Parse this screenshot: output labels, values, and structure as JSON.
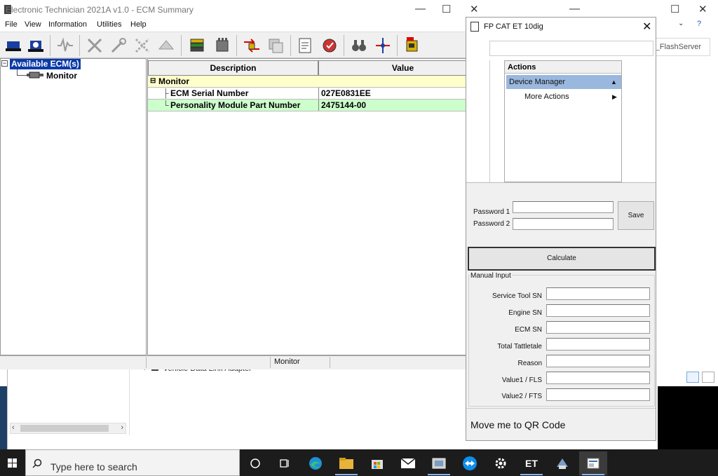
{
  "et_window": {
    "title": "Electronic Technician 2021A v1.0 - ECM Summary",
    "menu": [
      "File",
      "View",
      "Information",
      "Utilities",
      "Help"
    ],
    "tree": {
      "root_label": "Available ECM(s)",
      "child_label": "Monitor",
      "expander": "⊟"
    },
    "grid": {
      "headers": [
        "Description",
        "Value"
      ],
      "group_label": "Monitor",
      "group_expander": "⊟",
      "rows": [
        {
          "description": "ECM Serial Number",
          "value": "027E0831EE",
          "highlight": false
        },
        {
          "description": "Personality Module Part Number",
          "value": "2475144-00",
          "highlight": true
        }
      ]
    },
    "status": "Monitor",
    "colors": {
      "tree_selected": "#0a3aa8",
      "group_row": "#ffffcc",
      "highlight_row": "#ccffcc"
    }
  },
  "background_window": {
    "search_text": "ch dll_for_FlashServer",
    "bottom_row": "Vehicle Data Link Adapter"
  },
  "fp_dialog": {
    "title": "FP CAT ET 10dig",
    "actions": {
      "header": "Actions",
      "items": [
        {
          "label": "Device Manager",
          "selected": true
        },
        {
          "label": "More Actions",
          "selected": false
        }
      ]
    },
    "password1_label": "Password 1",
    "password2_label": "Password 2",
    "password1_value": "",
    "password2_value": "",
    "save_label": "Save",
    "calculate_label": "Calculate",
    "manual_input": {
      "group_label": "Manual Input",
      "fields": [
        {
          "label": "Service Tool SN",
          "value": ""
        },
        {
          "label": "Engine SN",
          "value": ""
        },
        {
          "label": "ECM SN",
          "value": ""
        },
        {
          "label": "Total Tattletale",
          "value": ""
        },
        {
          "label": "Reason",
          "value": ""
        },
        {
          "label": "Value1 / FLS",
          "value": ""
        },
        {
          "label": "Value2 / FTS",
          "value": ""
        }
      ]
    },
    "footer_text": "Move me to QR Code"
  },
  "taskbar": {
    "search_placeholder": "Type here to search",
    "et_label": "ET"
  }
}
